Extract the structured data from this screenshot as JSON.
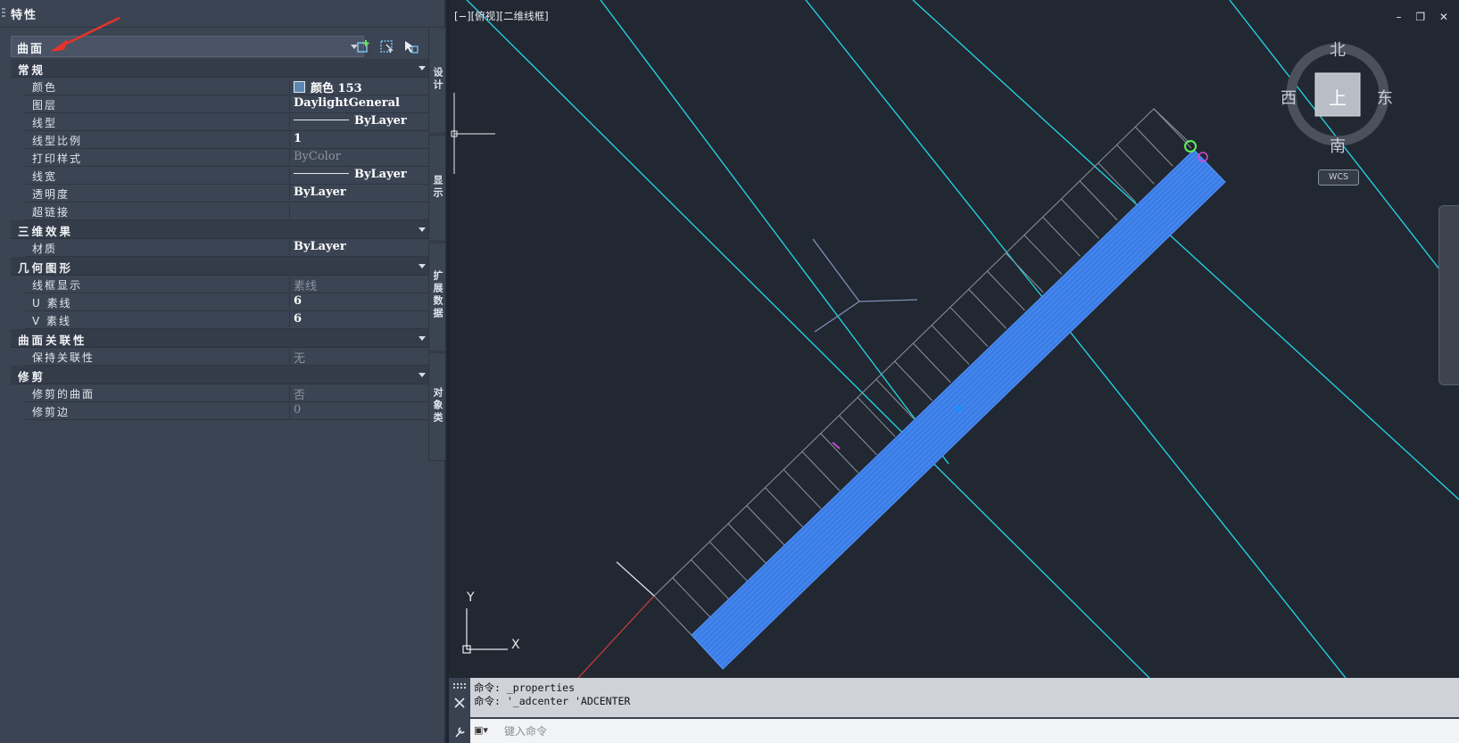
{
  "panel": {
    "title": "特性",
    "object_type": "曲面"
  },
  "sections": [
    {
      "title": "常规",
      "rows": [
        {
          "name": "颜色",
          "value": "颜色 153",
          "kind": "color",
          "swatch": "#5c87b2"
        },
        {
          "name": "图层",
          "value": "DaylightGeneral"
        },
        {
          "name": "线型",
          "value": "ByLayer",
          "kind": "line"
        },
        {
          "name": "线型比例",
          "value": "1"
        },
        {
          "name": "打印样式",
          "value": "ByColor",
          "dim": true
        },
        {
          "name": "线宽",
          "value": "ByLayer",
          "kind": "line"
        },
        {
          "name": "透明度",
          "value": "ByLayer"
        },
        {
          "name": "超链接",
          "value": ""
        }
      ]
    },
    {
      "title": "三维效果",
      "rows": [
        {
          "name": "材质",
          "value": "ByLayer"
        }
      ]
    },
    {
      "title": "几何图形",
      "rows": [
        {
          "name": "线框显示",
          "value": "素线",
          "dim": true
        },
        {
          "name": "U 素线",
          "value": "6"
        },
        {
          "name": "V 素线",
          "value": "6"
        }
      ]
    },
    {
      "title": "曲面关联性",
      "rows": [
        {
          "name": "保持关联性",
          "value": "无",
          "dim": true
        }
      ]
    },
    {
      "title": "修剪",
      "rows": [
        {
          "name": "修剪的曲面",
          "value": "否",
          "dim": true
        },
        {
          "name": "修剪边",
          "value": "0",
          "dim": true
        }
      ]
    }
  ],
  "side_tabs": [
    "设计",
    "显示",
    "扩展数据",
    "对象类"
  ],
  "viewport": {
    "label": "[−][俯视][二维线框]",
    "viewcube": {
      "north": "北",
      "south": "南",
      "east": "东",
      "west": "西",
      "top": "上"
    },
    "wcs": "WCS",
    "ucs_x": "X",
    "ucs_y": "Y",
    "window_controls": "– ❐ ✕"
  },
  "command": {
    "history": [
      "命令: _properties",
      "命令: '_adcenter 'ADCENTER"
    ],
    "placeholder": "键入命令",
    "prompt_icon": "▣▾"
  },
  "colors": {
    "accent_cyan": "#22d8e6",
    "surface_blue": "#3a7de6"
  }
}
